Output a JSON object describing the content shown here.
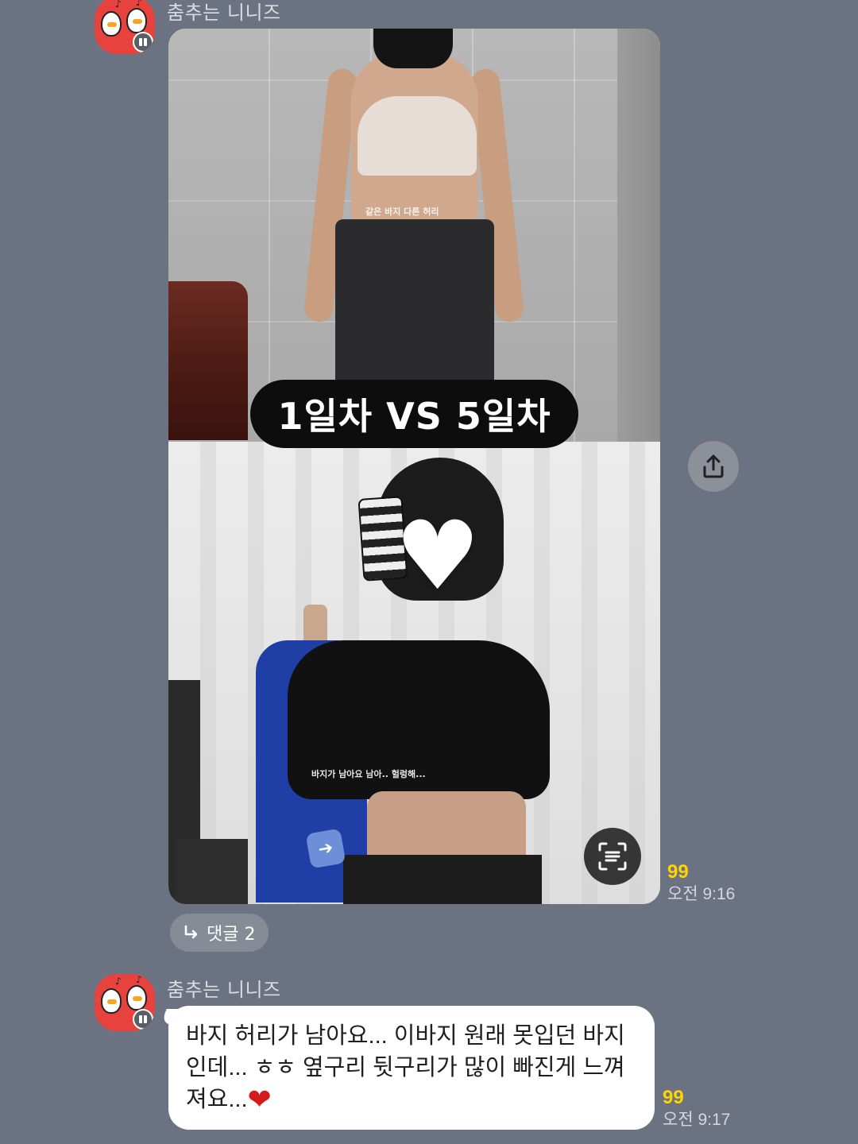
{
  "messages": [
    {
      "sender": "춤추는 니니즈",
      "photo": {
        "overlay_pill": "1일차 VS 5일차",
        "caption_top": "같은 바지 다른 허리",
        "caption_bottom": "바지가 남아요 남아.. 헐렁해...",
        "privacy_sticker": "heart-emoji"
      },
      "unread_count": "99",
      "time": "오전 9:16",
      "reply_label": "댓글 2"
    },
    {
      "sender": "춤추는 니니즈",
      "text": "바지 허리가 남아요... 이바지 원래 못입던 바지인데... ㅎㅎ 옆구리 뒷구리가 많이 빠진게 느껴져요...",
      "emoji": "❤",
      "unread_count": "99",
      "time": "오전 9:17"
    }
  ],
  "icons": {
    "share": "share-icon",
    "scan": "text-scan-icon",
    "reply_arrow": "reply-arrow-icon",
    "avatar_badge": "channel-badge-icon"
  },
  "colors": {
    "background": "#6b7383",
    "unread": "#ffd400",
    "bubble": "#ffffff"
  }
}
